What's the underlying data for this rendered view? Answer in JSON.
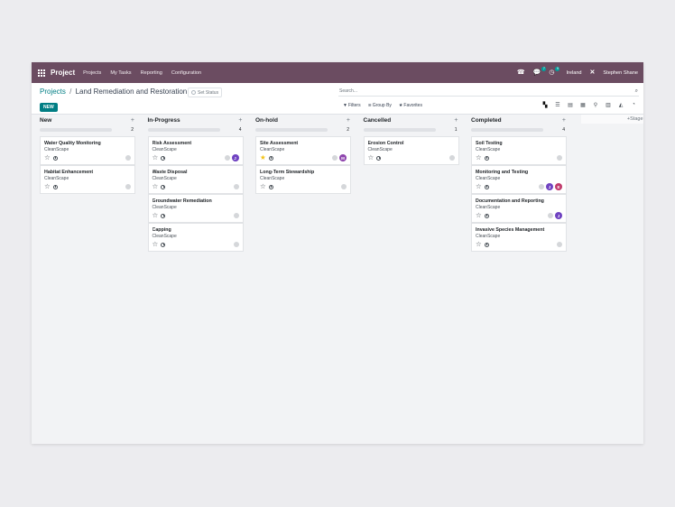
{
  "topbar": {
    "app_name": "Project",
    "menu": [
      "Projects",
      "My Tasks",
      "Reporting",
      "Configuration"
    ],
    "chat_badge": "7",
    "activity_badge": "9",
    "company": "Ireland",
    "user": "Stephen Shane",
    "bg_color": "#6b4c61"
  },
  "control": {
    "breadcrumb_parent": "Projects",
    "breadcrumb_sep": "/",
    "breadcrumb_current": "Land Remediation and Restoration",
    "set_status": "Set Status",
    "new_button": "NEW",
    "search_placeholder": "Search...",
    "filters_label": "Filters",
    "groupby_label": "Group By",
    "favorites_label": "Favorites"
  },
  "icons": {
    "star": "☆",
    "star_filled": "★",
    "search": "⌕",
    "plus": "+"
  },
  "columns": [
    {
      "name": "New",
      "count": "2",
      "cards": [
        {
          "title": "Water Quality Monitoring",
          "customer": "CleanScape",
          "starred": false,
          "avatars": []
        },
        {
          "title": "Habitat Enhancement",
          "customer": "CleanScape",
          "starred": false,
          "avatars": []
        }
      ]
    },
    {
      "name": "In-Progress",
      "count": "4",
      "cards": [
        {
          "title": "Risk Assessment",
          "customer": "CleanScape",
          "starred": false,
          "avatars": [
            {
              "letter": "J",
              "color": "#6f42c1"
            }
          ]
        },
        {
          "title": "Waste Disposal",
          "customer": "CleanScape",
          "starred": false,
          "avatars": []
        },
        {
          "title": "Groundwater Remediation",
          "customer": "CleanScape",
          "starred": false,
          "avatars": []
        },
        {
          "title": "Capping",
          "customer": "CleanScape",
          "starred": false,
          "avatars": []
        }
      ]
    },
    {
      "name": "On-hold",
      "count": "2",
      "cards": [
        {
          "title": "Site Assessment",
          "customer": "CleanScape",
          "starred": true,
          "avatars": [
            {
              "letter": "M",
              "color": "#8e44ad"
            }
          ]
        },
        {
          "title": "Long-Term Stewardship",
          "customer": "CleanScape",
          "starred": false,
          "avatars": []
        }
      ]
    },
    {
      "name": "Cancelled",
      "count": "1",
      "cards": [
        {
          "title": "Erosion Control",
          "customer": "CleanScape",
          "starred": false,
          "avatars": []
        }
      ]
    },
    {
      "name": "Completed",
      "count": "4",
      "cards": [
        {
          "title": "Soil Testing",
          "customer": "CleanScape",
          "starred": false,
          "avatars": []
        },
        {
          "title": "Monitoring and Testing",
          "customer": "CleanScape",
          "starred": false,
          "avatars": [
            {
              "letter": "J",
              "color": "#6f42c1"
            },
            {
              "letter": "E",
              "color": "#c0396b"
            }
          ]
        },
        {
          "title": "Documentation and Reporting",
          "customer": "CleanScape",
          "starred": false,
          "avatars": [
            {
              "letter": "J",
              "color": "#6f42c1"
            }
          ]
        },
        {
          "title": "Invasive Species Management",
          "customer": "CleanScape",
          "starred": false,
          "avatars": []
        }
      ]
    }
  ],
  "add_stage": "Stage"
}
